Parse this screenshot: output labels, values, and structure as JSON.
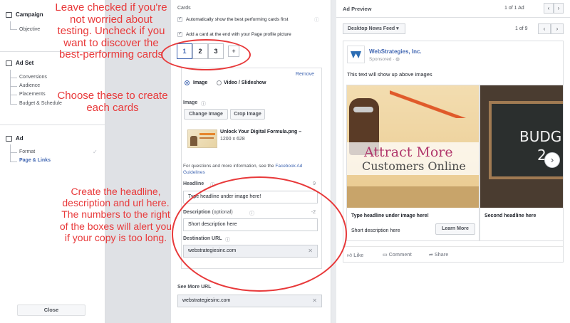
{
  "nav": {
    "campaign": "Campaign",
    "campaign_items": [
      "Objective"
    ],
    "adset": "Ad Set",
    "adset_items": [
      "Conversions",
      "Audience",
      "Placements",
      "Budget & Schedule"
    ],
    "ad": "Ad",
    "ad_items": [
      "Format",
      "Page & Links"
    ],
    "close": "Close"
  },
  "form": {
    "cards_label": "Cards",
    "auto_show": "Automatically show the best performing cards first",
    "add_card_end": "Add a card at the end with your Page profile picture",
    "card_tabs": [
      "1",
      "2",
      "3"
    ],
    "add_tab": "+",
    "remove": "Remove",
    "media_image": "Image",
    "media_video": "Video / Slideshow",
    "image_label": "Image",
    "change_image": "Change Image",
    "crop_image": "Crop Image",
    "file_name": "Unlock Your Digital Formula.png –",
    "file_size": "1200 x 628",
    "guidelines": "For questions and more information, see the",
    "guidelines_link": "Facebook Ad Guidelines",
    "headline_label": "Headline",
    "headline_count": "9",
    "headline_value": "Type headline under image here!",
    "desc_label": "Description",
    "desc_optional": "(optional)",
    "desc_count": "-2",
    "desc_value": "Short description here",
    "dest_label": "Destination URL",
    "dest_value": "webstrategiesinc.com",
    "see_more_label": "See More URL",
    "see_more_value": "webstrategiesinc.com"
  },
  "preview": {
    "title": "Ad Preview",
    "counter": "1 of 1 Ad",
    "placement": "Desktop News Feed",
    "card_counter": "1 of 9",
    "page_name": "WebStrategies, Inc.",
    "sponsored": "Sponsored",
    "post_text": "This text will show up above images",
    "card1_banner1": "Attract More",
    "card1_banner2": "Customers Online",
    "card1_headline": "Type headline under image here!",
    "card1_desc": "Short description here",
    "learn_more": "Learn More",
    "card2_board": "BUDG",
    "card2_board2": "2",
    "card2_headline": "Second headline here",
    "like": "Like",
    "comment": "Comment",
    "share": "Share"
  },
  "annotations": {
    "a1": "Leave checked if you're not worried about testing. Uncheck if you want to discover the best-performing cards",
    "a2": "Choose these to create each cards",
    "a3": "Create the headline, description and url here. The numbers to the right of the boxes will alert you if your copy is too long."
  },
  "colors": {
    "annotation": "#e8393a",
    "link": "#4267b2"
  }
}
